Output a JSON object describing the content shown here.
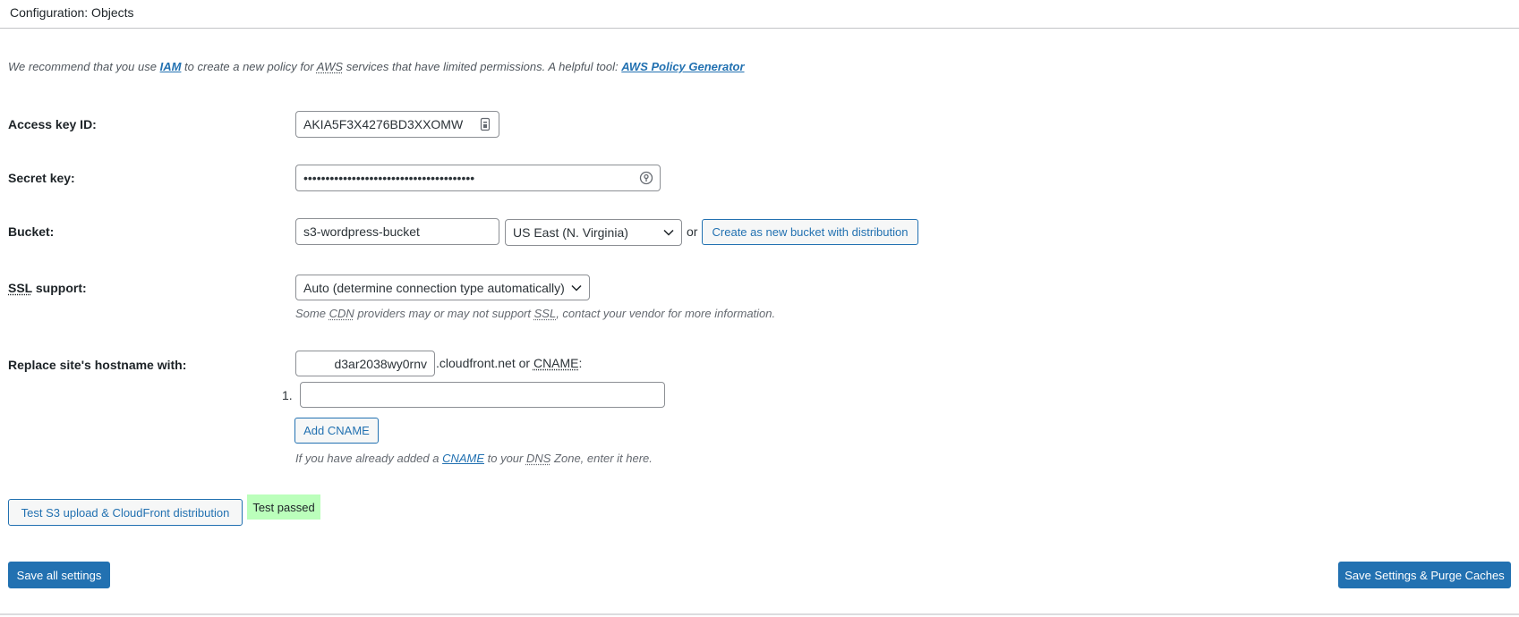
{
  "header": {
    "title": "Configuration: Objects"
  },
  "intro": {
    "prefix": "We recommend that you use ",
    "iam_link": "IAM",
    "middle": " to create a new policy for ",
    "aws_abbr": "AWS",
    "suffix": " services that have limited permissions. A helpful tool: ",
    "policy_link": "AWS Policy Generator"
  },
  "access_key": {
    "label": "Access key ID:",
    "value": "AKIA5F3X4276BD3XXOMW"
  },
  "secret_key": {
    "label": "Secret key:",
    "value": "•••••••••••••••••••••••••••••••••••••••"
  },
  "bucket": {
    "label": "Bucket:",
    "value": "s3-wordpress-bucket",
    "region_selected": "US East (N. Virginia)",
    "or_text": "or",
    "create_button": "Create as new bucket with distribution"
  },
  "ssl": {
    "label_abbr": "SSL",
    "label_rest": " support:",
    "selected": "Auto (determine connection type automatically)",
    "desc_prefix": "Some ",
    "desc_cdn": "CDN",
    "desc_middle": " providers may or may not support ",
    "desc_ssl": "SSL",
    "desc_suffix": ", contact your vendor for more information."
  },
  "hostname": {
    "label": "Replace site's hostname with:",
    "subdomain_value": "d3ar2038wy0rnv",
    "domain_suffix": ".cloudfront.net or ",
    "cname_abbr": "CNAME",
    "colon": ":",
    "cname_index": "1.",
    "cname_value": "",
    "add_cname_button": "Add CNAME",
    "desc_prefix": "If you have already added a ",
    "desc_cname": "CNAME",
    "desc_middle": " to your ",
    "desc_dns": "DNS",
    "desc_suffix": " Zone, enter it here."
  },
  "test": {
    "button": "Test S3 upload & CloudFront distribution",
    "status": "Test passed",
    "status_color": "#bbffbb"
  },
  "footer": {
    "save_all": "Save all settings",
    "save_purge": "Save Settings & Purge Caches"
  },
  "colors": {
    "accent": "#2271b1",
    "border": "#8c8f94"
  }
}
